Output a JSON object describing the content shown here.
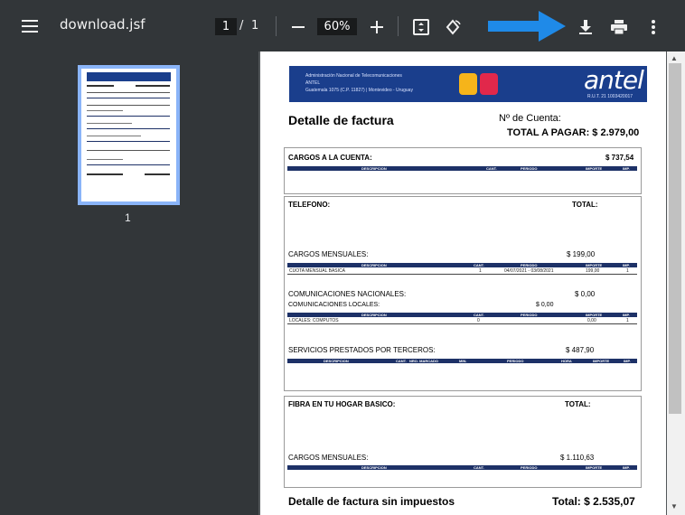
{
  "toolbar": {
    "title": "download.jsf",
    "page_current": "1",
    "page_sep": "/",
    "page_total": "1",
    "zoom": "60%"
  },
  "sidebar": {
    "thumb_label": "1"
  },
  "doc": {
    "header_org": "Administración Nacional de Telecomunicaciones",
    "header_antel_small": "ANTEL",
    "header_address": "Guatemala 1075 (C.P. 11827) | Montevideo - Uruguay",
    "brand": "antel",
    "rut": "R.U.T. 21 1003420017",
    "title": "Detalle de factura",
    "account_label": "Nº de Cuenta:",
    "total_label": "TOTAL A PAGAR: $ 2.979,00",
    "cargos": {
      "label": "CARGOS A LA CUENTA:",
      "amount": "$ 737,54"
    },
    "cols": {
      "descripcion": "DESCRIPCION",
      "cant": "CANT.",
      "periodo": "PERIODO",
      "importe": "IMPORTE",
      "imp": "IMP.",
      "nro_marcado": "NRO. MARCADO",
      "min": "MIN.",
      "hora": "HORA"
    },
    "telefono": {
      "label": "TELEFONO:",
      "total_label": "TOTAL:",
      "cargos_mensuales": "CARGOS MENSUALES:",
      "cargos_mensuales_amt": "$ 199,00",
      "row1": {
        "desc": "CUOTA MENSUAL BASICA",
        "cant": "1",
        "periodo": "04/07/2021 - 03/08/2021",
        "importe": "199,00",
        "imp": "1"
      },
      "com_nac": "COMUNICACIONES NACIONALES:",
      "com_nac_amt": "$ 0,00",
      "com_loc": "COMUNICACIONES LOCALES:",
      "com_loc_amt": "$ 0,00",
      "row2": {
        "desc": "LOCALES: COMPUTOS",
        "cant": "0",
        "importe": "0,00",
        "imp": "1"
      },
      "terceros": "SERVICIOS PRESTADOS POR TERCEROS:",
      "terceros_amt": "$ 487,90"
    },
    "fibra": {
      "label": "FIBRA EN TU HOGAR BASICO:",
      "total_label": "TOTAL:",
      "cargos_mensuales": "CARGOS MENSUALES:",
      "cargos_mensuales_amt": "$ 1.110,63"
    },
    "footer_title": "Detalle de factura sin impuestos",
    "footer_total": "Total: $ 2.535,07"
  }
}
